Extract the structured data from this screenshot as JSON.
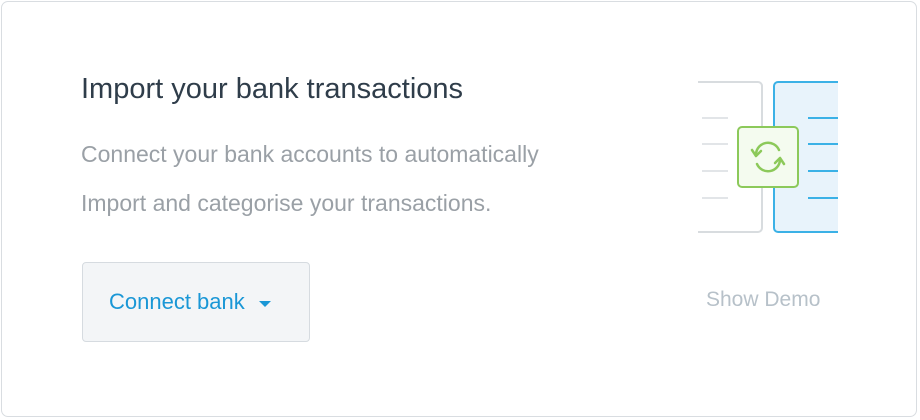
{
  "card": {
    "title": "Import your bank transactions",
    "description_line1": "Connect your bank accounts to automatically",
    "description_line2": "Import and categorise your transactions.",
    "connect_button_label": "Connect bank",
    "connect_button_icon": "caret-down-icon",
    "show_demo_label": "Show Demo",
    "illustration_icon": "sync-icon"
  },
  "colors": {
    "accent_blue": "#1a97d6",
    "sync_green": "#8cc95a",
    "title_text": "#2f3d4a",
    "muted_text": "#9aa0a6",
    "demo_link": "#b7c1c9"
  }
}
